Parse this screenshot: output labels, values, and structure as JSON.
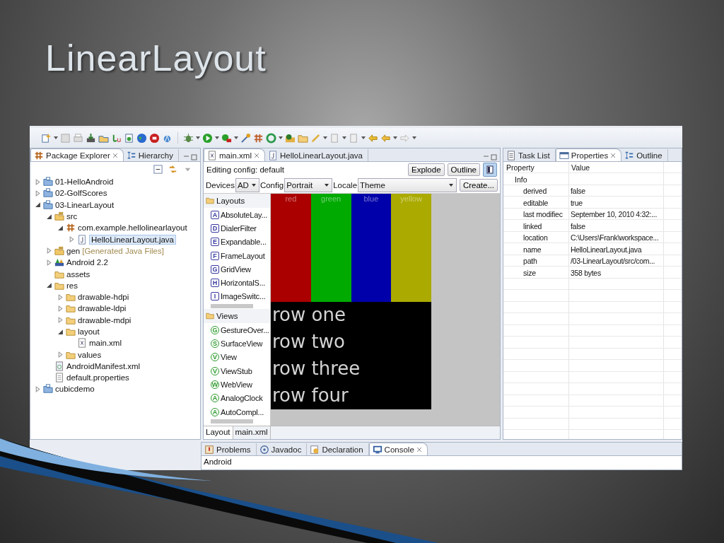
{
  "slide": {
    "title": "LinearLayout"
  },
  "package_explorer": {
    "tabs": [
      {
        "label": "Package Explorer",
        "selected": true
      },
      {
        "label": "Hierarchy",
        "selected": false
      }
    ],
    "tree": [
      {
        "label": "01-HelloAndroid",
        "kind": "project",
        "expanded": false,
        "selected": false
      },
      {
        "label": "02-GolfScores",
        "kind": "project",
        "expanded": false,
        "selected": false
      },
      {
        "label": "03-LinearLayout",
        "kind": "project",
        "expanded": true,
        "selected": false,
        "children": [
          {
            "label": "src",
            "kind": "source",
            "expanded": true,
            "selected": false,
            "children": [
              {
                "label": "com.example.hellolinearlayout",
                "kind": "package",
                "expanded": true,
                "selected": false,
                "children": [
                  {
                    "label": "HelloLinearLayout.java",
                    "kind": "java",
                    "expanded": false,
                    "selected": true
                  }
                ]
              }
            ]
          },
          {
            "label": "gen",
            "note": "[Generated Java Files]",
            "kind": "source",
            "expanded": false,
            "selected": false
          },
          {
            "label": "Android 2.2",
            "kind": "library",
            "expanded": false,
            "selected": false
          },
          {
            "label": "assets",
            "kind": "folder",
            "selected": false
          },
          {
            "label": "res",
            "kind": "folder",
            "expanded": true,
            "selected": false,
            "children": [
              {
                "label": "drawable-hdpi",
                "kind": "folder",
                "expanded": false,
                "selected": false
              },
              {
                "label": "drawable-ldpi",
                "kind": "folder",
                "expanded": false,
                "selected": false
              },
              {
                "label": "drawable-mdpi",
                "kind": "folder",
                "expanded": false,
                "selected": false
              },
              {
                "label": "layout",
                "kind": "folder",
                "expanded": true,
                "selected": false,
                "children": [
                  {
                    "label": "main.xml",
                    "kind": "xml",
                    "selected": false
                  }
                ]
              },
              {
                "label": "values",
                "kind": "folder",
                "expanded": false,
                "selected": false
              }
            ]
          },
          {
            "label": "AndroidManifest.xml",
            "kind": "manifest",
            "selected": false
          },
          {
            "label": "default.properties",
            "kind": "file",
            "selected": false
          }
        ]
      },
      {
        "label": "cubicdemo",
        "kind": "project",
        "expanded": false,
        "selected": false
      }
    ]
  },
  "editor": {
    "tabs": [
      {
        "label": "main.xml",
        "kind": "xml",
        "selected": true
      },
      {
        "label": "HelloLinearLayout.java",
        "kind": "java",
        "selected": false
      }
    ],
    "editing_config": "Editing config: default",
    "buttons": [
      "Explode",
      "Outline"
    ],
    "toggle": {
      "on": true
    },
    "config_row": [
      {
        "label": "Devices",
        "value": "AD"
      },
      {
        "label": "Config",
        "value": "Portrait"
      },
      {
        "label": "Locale",
        "value": "Theme"
      }
    ],
    "create_button": "Create...",
    "palette": [
      {
        "label": "Layouts",
        "color": "#3a3aa0",
        "items": [
          {
            "badge": "A",
            "label": "AbsoluteLay..."
          },
          {
            "badge": "D",
            "label": "DialerFilter"
          },
          {
            "badge": "E",
            "label": "Expandable..."
          },
          {
            "badge": "F",
            "label": "FrameLayout"
          },
          {
            "badge": "G",
            "label": "GridView"
          },
          {
            "badge": "H",
            "label": "HorizontalS..."
          },
          {
            "badge": "I",
            "label": "ImageSwitc..."
          }
        ]
      },
      {
        "label": "Views",
        "color": "#2e9a2e",
        "items": [
          {
            "badge": "G",
            "label": "GestureOver..."
          },
          {
            "badge": "S",
            "label": "SurfaceView"
          },
          {
            "badge": "V",
            "label": "View"
          },
          {
            "badge": "V",
            "label": "ViewStub"
          },
          {
            "badge": "W",
            "label": "WebView"
          },
          {
            "badge": "A",
            "label": "AnalogClock"
          },
          {
            "badge": "A",
            "label": "AutoCompl..."
          }
        ]
      }
    ],
    "canvas": {
      "columns": [
        {
          "label": "red",
          "color": "#aa0000"
        },
        {
          "label": "green",
          "color": "#00aa00"
        },
        {
          "label": "blue",
          "color": "#0000aa"
        },
        {
          "label": "yellow",
          "color": "#aaaa00"
        }
      ],
      "rows": [
        "row one",
        "row two",
        "row three",
        "row four"
      ]
    },
    "bottom_tabs": [
      {
        "label": "Layout",
        "selected": true
      },
      {
        "label": "main.xml",
        "selected": false
      }
    ]
  },
  "properties": {
    "tabs": [
      {
        "label": "Task List",
        "kind": "tasks",
        "selected": false
      },
      {
        "label": "Properties",
        "kind": "properties",
        "selected": true
      },
      {
        "label": "Outline",
        "kind": "outline",
        "selected": false
      }
    ],
    "columns": [
      "Property",
      "Value"
    ],
    "group": "Info",
    "rows": [
      {
        "property": "derived",
        "value": "false"
      },
      {
        "property": "editable",
        "value": "true"
      },
      {
        "property": "last modifiec",
        "value": "September 10, 2010 4:32:..."
      },
      {
        "property": "linked",
        "value": "false"
      },
      {
        "property": "location",
        "value": "C:\\Users\\Frank\\workspace..."
      },
      {
        "property": "name",
        "value": "HelloLinearLayout.java"
      },
      {
        "property": "path",
        "value": "/03-LinearLayout/src/com..."
      },
      {
        "property": "size",
        "value": "358  bytes"
      }
    ]
  },
  "console": {
    "tabs": [
      {
        "label": "Problems",
        "kind": "problems",
        "selected": false
      },
      {
        "label": "Javadoc",
        "kind": "javadoc",
        "selected": false
      },
      {
        "label": "Declaration",
        "kind": "declaration",
        "selected": false
      },
      {
        "label": "Console",
        "kind": "console",
        "selected": true
      }
    ],
    "text": "Android"
  }
}
